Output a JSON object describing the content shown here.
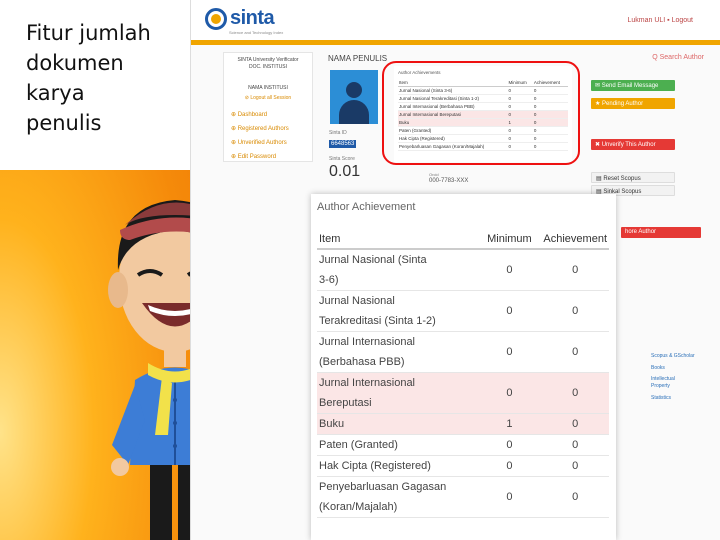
{
  "slide": {
    "title_lines": [
      "Fitur jumlah",
      "dokumen",
      "karya",
      "penulis"
    ]
  },
  "app": {
    "logo_text": "sinta",
    "logo_sub": "Science and Technology Index",
    "user_menu": "Lukman ULI  ▪ Logout",
    "search_author": "Q Search Author",
    "brand_color": "#1f5aa8",
    "accent_color": "#f0a500"
  },
  "profile": {
    "line1": "SINTA University Verificator",
    "line2": "DOC. INSTITUSI",
    "line3": "NAMA INSTITUSI",
    "edit_link": "⊘ Logout all Session",
    "menu": [
      "⊕ Dashboard",
      "⊕ Registered Authors",
      "⊕ Unverified Authors",
      "⊕ Edit Password"
    ]
  },
  "author": {
    "name_label": "NAMA PENULIS",
    "sinta_id_label": "Sinta ID",
    "sinta_id": "6648563",
    "sinta_score_label": "Sinta Score",
    "sinta_score": "0.01",
    "orcid_label": "Orcid",
    "orcid": "000-7783-XXX"
  },
  "small_table": {
    "title": "Author Achievements",
    "headers": [
      "Item",
      "Minimum",
      "Achievement"
    ],
    "rows": [
      [
        "Jurnal Nasional (Sinta 3-6)",
        "0",
        "0"
      ],
      [
        "Jurnal Nasional Terakreditasi (Sinta 1-2)",
        "0",
        "0"
      ],
      [
        "Jurnal Internasional (Berbahasa PBB)",
        "0",
        "0"
      ],
      [
        "Jurnal Internasional Bereputasi",
        "0",
        "0"
      ],
      [
        "Buku",
        "1",
        "0"
      ],
      [
        "Paten (Granted)",
        "0",
        "0"
      ],
      [
        "Hak Cipta (Registered)",
        "0",
        "0"
      ],
      [
        "Penyebarluasan Gagasan (Koran/Majalah)",
        "0",
        "0"
      ]
    ]
  },
  "buttons": {
    "send_email": "✉ Send Email Message",
    "pending": "★ Pending Author",
    "unverify": "✖ Unverify This Author",
    "reset_scopus": "▤ Reset Scopus",
    "sync_scopus": "▤ Sinkal Scopus",
    "red2": "hore Author"
  },
  "side_links": [
    "Scopus & GScholar",
    "Books",
    "Intellectual Property",
    "Statistics"
  ],
  "zoom_table": {
    "title": "Author Achievement",
    "headers": [
      "Item",
      "Minimum",
      "Achievement"
    ],
    "rows": [
      {
        "lines": [
          "Jurnal Nasional (Sinta",
          "3-6)"
        ],
        "min": "0",
        "ach": "0",
        "hl": false
      },
      {
        "lines": [
          "Jurnal Nasional",
          "Terakreditasi (Sinta 1-2)"
        ],
        "min": "0",
        "ach": "0",
        "hl": false
      },
      {
        "lines": [
          "Jurnal Internasional",
          "(Berbahasa PBB)"
        ],
        "min": "0",
        "ach": "0",
        "hl": false
      },
      {
        "lines": [
          "Jurnal Internasional",
          "Bereputasi"
        ],
        "min": "0",
        "ach": "0",
        "hl": true
      },
      {
        "lines": [
          "Buku"
        ],
        "min": "1",
        "ach": "0",
        "hl": true
      },
      {
        "lines": [
          "Paten (Granted)"
        ],
        "min": "0",
        "ach": "0",
        "hl": false
      },
      {
        "lines": [
          "Hak Cipta (Registered)"
        ],
        "min": "0",
        "ach": "0",
        "hl": false
      },
      {
        "lines": [
          "Penyebarluasan Gagasan",
          "(Koran/Majalah)"
        ],
        "min": "0",
        "ach": "0",
        "hl": false
      }
    ],
    "highlight_color": "#fbe6e6"
  }
}
